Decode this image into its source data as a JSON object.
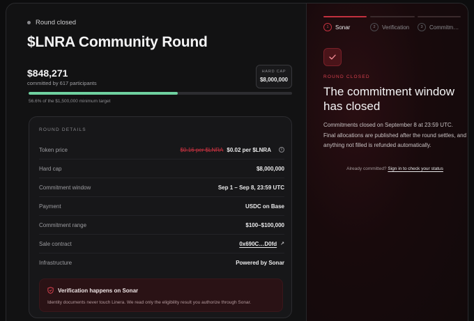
{
  "round": {
    "status": "Round closed",
    "title": "$LNRA Community Round",
    "committed_amount": "$848,271",
    "committed_participants": "committed by 617 participants",
    "hard_cap_label": "HARD CAP",
    "hard_cap_value": "$8,000,000",
    "progress_fraction": 0.566,
    "progress_note": "56.6% of the $1,500,000 minimum target",
    "progress_color": "#6fd1a0"
  },
  "details": {
    "header": "ROUND DETAILS",
    "token_price": {
      "label": "Token price",
      "old": "$0.16 per $LNRA",
      "new": "$0.02 per $LNRA"
    },
    "hard_cap": {
      "label": "Hard cap",
      "value": "$8,000,000"
    },
    "window": {
      "label": "Commitment window",
      "value": "Sep 1 – Sep 8, 23:59 UTC"
    },
    "payment": {
      "label": "Payment",
      "value": "USDC on Base"
    },
    "range": {
      "label": "Commitment range",
      "value": "$100–$100,000"
    },
    "contract": {
      "label": "Sale contract",
      "value": "0x690C…D0fd"
    },
    "infra": {
      "label": "Infrastructure",
      "value": "Powered by Sonar"
    }
  },
  "verification": {
    "title": "Verification happens on Sonar",
    "description": "Identity documents never touch Linera. We read only the eligibility result you authorize through Sonar."
  },
  "steps": [
    {
      "num": "1",
      "label": "Sonar",
      "active": true
    },
    {
      "num": "2",
      "label": "Verification",
      "active": false
    },
    {
      "num": "3",
      "label": "Commitm…",
      "active": false
    }
  ],
  "closed_panel": {
    "label": "ROUND CLOSED",
    "title": "The commitment window has closed",
    "body": "Commitments closed on September 8 at 23:59 UTC. Final allocations are published after the round settles, and anything not filled is refunded automatically.",
    "footer_prefix": "Already committed?",
    "footer_link": "Sign in to check your status"
  },
  "colors": {
    "accent": "#c3313f",
    "accent_label": "#d8404e"
  }
}
